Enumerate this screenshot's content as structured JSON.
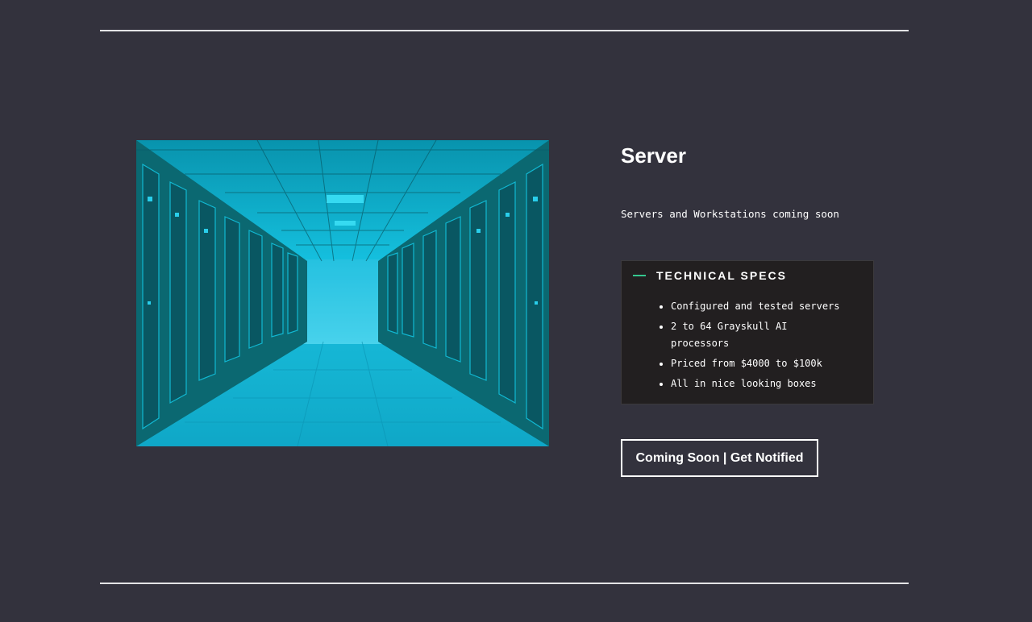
{
  "product": {
    "title": "Server",
    "subtitle": "Servers and Workstations coming soon"
  },
  "specs": {
    "heading": "TECHNICAL SPECS",
    "items": [
      "Configured and tested servers",
      "2 to 64 Grayskull AI processors",
      "Priced from $4000 to $100k",
      "All in nice looking boxes"
    ]
  },
  "cta": {
    "label": "Coming Soon | Get Notified"
  },
  "colors": {
    "background": "#33323d",
    "panel": "#221f20",
    "accent": "#35c68e",
    "image_tint": "#00b4d8"
  }
}
